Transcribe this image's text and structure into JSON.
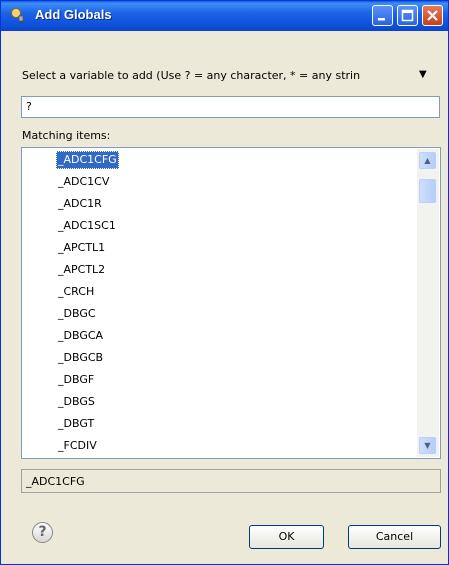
{
  "window": {
    "title": "Add Globals",
    "icon": "plug-icon",
    "controls": {
      "minimize": "minimize-icon",
      "maximize": "maximize-icon",
      "close": "close-icon"
    }
  },
  "prompt": {
    "text": "Select a variable to add (Use ? = any character, * = any strin",
    "menu_icon": "triangle-down-icon"
  },
  "filter": {
    "value": "?"
  },
  "matching": {
    "label": "Matching items:",
    "items": [
      "_ADC1CFG",
      "_ADC1CV",
      "_ADC1R",
      "_ADC1SC1",
      "_APCTL1",
      "_APCTL2",
      "_CRCH",
      "_DBGC",
      "_DBGCA",
      "_DBGCB",
      "_DBGF",
      "_DBGS",
      "_DBGT",
      "_FCDIV"
    ],
    "selected_index": 0
  },
  "status": {
    "text": "_ADC1CFG"
  },
  "buttons": {
    "ok": "OK",
    "cancel": "Cancel",
    "help_icon": "help-icon"
  },
  "colors": {
    "title_bar": "#0a54e0",
    "selection": "#316ac5",
    "dialog_bg": "#ece9d8",
    "close_button": "#d5542f"
  }
}
